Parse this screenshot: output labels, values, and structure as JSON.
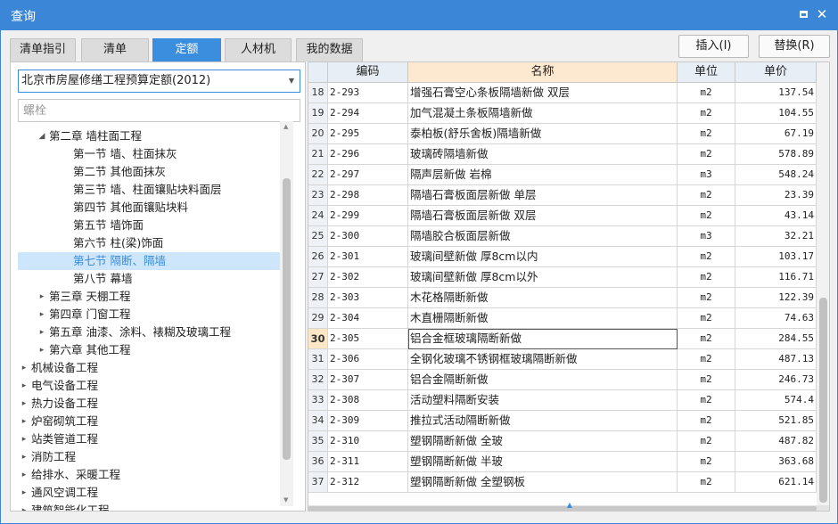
{
  "window": {
    "title": "查询",
    "maximize_label": "maximize",
    "close_label": "✕"
  },
  "tabs": [
    {
      "label": "清单指引"
    },
    {
      "label": "清单"
    },
    {
      "label": "定额"
    },
    {
      "label": "人材机"
    },
    {
      "label": "我的数据"
    }
  ],
  "active_tab": "定额",
  "buttons": {
    "insert": "插入(I)",
    "replace": "替换(R)"
  },
  "library": {
    "selected": "北京市房屋修缮工程预算定额(2012)"
  },
  "search": {
    "value": "",
    "placeholder": "螺栓"
  },
  "tree": [
    {
      "label": "第二章 墙柱面工程",
      "indent": 2,
      "toggle": "◢",
      "selected": false
    },
    {
      "label": "第一节 墙、柱面抹灰",
      "indent": 3,
      "toggle": "",
      "selected": false
    },
    {
      "label": "第二节 其他面抹灰",
      "indent": 3,
      "toggle": "",
      "selected": false
    },
    {
      "label": "第三节 墙、柱面镶贴块料面层",
      "indent": 3,
      "toggle": "",
      "selected": false
    },
    {
      "label": "第四节 其他面镶贴块料",
      "indent": 3,
      "toggle": "",
      "selected": false
    },
    {
      "label": "第五节 墙饰面",
      "indent": 3,
      "toggle": "",
      "selected": false
    },
    {
      "label": "第六节 柱(梁)饰面",
      "indent": 3,
      "toggle": "",
      "selected": false
    },
    {
      "label": "第七节 隔断、隔墙",
      "indent": 3,
      "toggle": "",
      "selected": true
    },
    {
      "label": "第八节 幕墙",
      "indent": 3,
      "toggle": "",
      "selected": false
    },
    {
      "label": "第三章 天棚工程",
      "indent": 2,
      "toggle": "▸",
      "selected": false
    },
    {
      "label": "第四章 门窗工程",
      "indent": 2,
      "toggle": "▸",
      "selected": false
    },
    {
      "label": "第五章 油漆、涂料、裱糊及玻璃工程",
      "indent": 2,
      "toggle": "▸",
      "selected": false
    },
    {
      "label": "第六章 其他工程",
      "indent": 2,
      "toggle": "▸",
      "selected": false
    },
    {
      "label": "机械设备工程",
      "indent": 1,
      "toggle": "▸",
      "selected": false
    },
    {
      "label": "电气设备工程",
      "indent": 1,
      "toggle": "▸",
      "selected": false
    },
    {
      "label": "热力设备工程",
      "indent": 1,
      "toggle": "▸",
      "selected": false
    },
    {
      "label": "炉窑砌筑工程",
      "indent": 1,
      "toggle": "▸",
      "selected": false
    },
    {
      "label": "站类管道工程",
      "indent": 1,
      "toggle": "▸",
      "selected": false
    },
    {
      "label": "消防工程",
      "indent": 1,
      "toggle": "▸",
      "selected": false
    },
    {
      "label": "给排水、采暖工程",
      "indent": 1,
      "toggle": "▸",
      "selected": false
    },
    {
      "label": "通风空调工程",
      "indent": 1,
      "toggle": "▸",
      "selected": false
    },
    {
      "label": "建筑智能化工程",
      "indent": 1,
      "toggle": "▸",
      "selected": false
    }
  ],
  "table": {
    "columns": {
      "code": "编码",
      "name": "名称",
      "unit": "单位",
      "price": "单价"
    },
    "current_row": 30,
    "rows": [
      {
        "idx": "18",
        "code": "2-293",
        "name": "增强石膏空心条板隔墙新做 双层",
        "unit": "m2",
        "price": "137.54"
      },
      {
        "idx": "19",
        "code": "2-294",
        "name": "加气混凝土条板隔墙新做",
        "unit": "m2",
        "price": "104.55"
      },
      {
        "idx": "20",
        "code": "2-295",
        "name": "泰柏板(舒乐舍板)隔墙新做",
        "unit": "m2",
        "price": "67.19"
      },
      {
        "idx": "21",
        "code": "2-296",
        "name": "玻璃砖隔墙新做",
        "unit": "m2",
        "price": "578.89"
      },
      {
        "idx": "22",
        "code": "2-297",
        "name": "隔声层新做 岩棉",
        "unit": "m3",
        "price": "548.24"
      },
      {
        "idx": "23",
        "code": "2-298",
        "name": "隔墙石膏板面层新做 单层",
        "unit": "m2",
        "price": "23.39"
      },
      {
        "idx": "24",
        "code": "2-299",
        "name": "隔墙石膏板面层新做 双层",
        "unit": "m2",
        "price": "43.14"
      },
      {
        "idx": "25",
        "code": "2-300",
        "name": "隔墙胶合板面层新做",
        "unit": "m3",
        "price": "32.21"
      },
      {
        "idx": "26",
        "code": "2-301",
        "name": "玻璃间壁新做 厚8cm以内",
        "unit": "m2",
        "price": "103.17"
      },
      {
        "idx": "27",
        "code": "2-302",
        "name": "玻璃间壁新做 厚8cm以外",
        "unit": "m2",
        "price": "116.71"
      },
      {
        "idx": "28",
        "code": "2-303",
        "name": "木花格隔断新做",
        "unit": "m2",
        "price": "122.39"
      },
      {
        "idx": "29",
        "code": "2-304",
        "name": "木直栅隔断新做",
        "unit": "m2",
        "price": "74.63"
      },
      {
        "idx": "30",
        "code": "2-305",
        "name": "铝合金框玻璃隔断新做",
        "unit": "m2",
        "price": "284.55"
      },
      {
        "idx": "31",
        "code": "2-306",
        "name": "全钢化玻璃不锈钢框玻璃隔断新做",
        "unit": "m2",
        "price": "487.13"
      },
      {
        "idx": "32",
        "code": "2-307",
        "name": "铝合金隔断新做",
        "unit": "m2",
        "price": "246.73"
      },
      {
        "idx": "33",
        "code": "2-308",
        "name": "活动塑料隔断安装",
        "unit": "m2",
        "price": "574.4"
      },
      {
        "idx": "34",
        "code": "2-309",
        "name": "推拉式活动隔断新做",
        "unit": "m2",
        "price": "521.85"
      },
      {
        "idx": "35",
        "code": "2-310",
        "name": "塑钢隔断新做 全玻",
        "unit": "m2",
        "price": "487.82"
      },
      {
        "idx": "36",
        "code": "2-311",
        "name": "塑钢隔断新做 半玻",
        "unit": "m2",
        "price": "363.68"
      },
      {
        "idx": "37",
        "code": "2-312",
        "name": "塑钢隔断新做 全塑钢板",
        "unit": "m2",
        "price": "621.14"
      }
    ]
  },
  "colors": {
    "titlebar": "#3b86d6",
    "active_tab": "#3b8ede",
    "selected_tree": "#cde6fb",
    "header_active": "#fde8d0"
  }
}
